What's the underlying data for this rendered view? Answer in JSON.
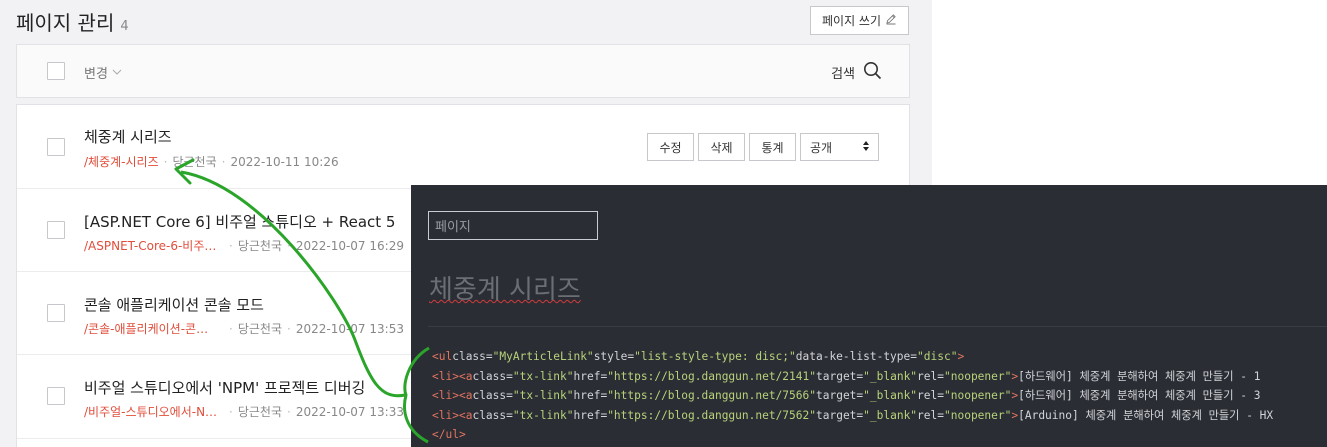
{
  "header": {
    "title": "페이지 관리",
    "count": "4",
    "write_button": "페이지 쓰기"
  },
  "toolbar": {
    "change_label": "변경",
    "search_label": "검색"
  },
  "rows": [
    {
      "title": "체중계 시리즈",
      "slug": "/체중계-시리즈",
      "author": "당근천국",
      "date": "2022-10-11 10:26"
    },
    {
      "title": "[ASP.NET Core 6] 비주얼 스튜디오 + React 5",
      "slug": "/ASPNET-Core-6-비주…",
      "author": "당근천국",
      "date": "2022-10-07 16:29"
    },
    {
      "title": "콘솔 애플리케이션 콘솔 모드",
      "slug": "/콘솔-애플리케이션-콘…",
      "author": "당근천국",
      "date": "2022-10-07 13:53"
    },
    {
      "title": "비주얼 스튜디오에서 'NPM' 프로젝트 디버깅",
      "slug": "/비주얼-스튜디오에서-N…",
      "author": "당근천국",
      "date": "2022-10-07 13:33"
    }
  ],
  "row_actions": {
    "edit": "수정",
    "delete": "삭제",
    "stats": "통계",
    "visibility": "공개"
  },
  "editor": {
    "input_value": "페이지",
    "title": "체중계 시리즈",
    "code_lines": [
      "<ul class=\"MyArticleLink\" style=\"list-style-type: disc;\" data-ke-list-type=\"disc\">",
      "<li><a class=\"tx-link\" href=\"https://blog.danggun.net/2141\" target=\"_blank\" rel=\"noopener\">[하드웨어] 체중계 분해하여 체중계 만들기 - 1",
      "<li><a class=\"tx-link\" href=\"https://blog.danggun.net/7566\" target=\"_blank\" rel=\"noopener\">[하드웨어] 체중계 분해하여 체중계 만들기 - 3",
      "<li><a class=\"tx-link\" href=\"https://blog.danggun.net/7562\" target=\"_blank\" rel=\"noopener\">[Arduino] 체중계 분해하여 체중계 만들기 - HX",
      "</ul>"
    ]
  },
  "colors": {
    "slug": "#e04d3a",
    "editor_bg": "#2a2d34",
    "annotation_arrow": "#2aa52a"
  }
}
